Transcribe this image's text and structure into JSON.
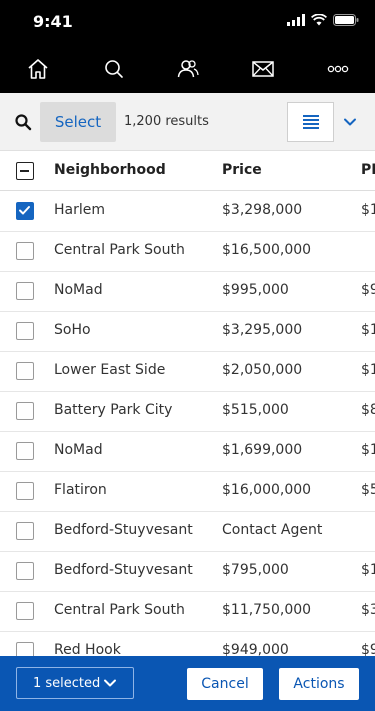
{
  "status": {
    "time": "9:41"
  },
  "nav": {
    "items": [
      {
        "icon": "home-icon"
      },
      {
        "icon": "search-icon"
      },
      {
        "icon": "people-icon"
      },
      {
        "icon": "mail-icon"
      },
      {
        "icon": "more-icon"
      }
    ]
  },
  "toolbar": {
    "select_label": "Select",
    "results_text": "1,200 results"
  },
  "table": {
    "columns": [
      "Neighborhood",
      "Price",
      "PP"
    ],
    "rows": [
      {
        "neighborhood": "Harlem",
        "price": "$3,298,000",
        "pp": "$1",
        "checked": true
      },
      {
        "neighborhood": "Central Park South",
        "price": "$16,500,000",
        "pp": "",
        "checked": false
      },
      {
        "neighborhood": "NoMad",
        "price": "$995,000",
        "pp": "$9",
        "checked": false
      },
      {
        "neighborhood": "SoHo",
        "price": "$3,295,000",
        "pp": "$1",
        "checked": false
      },
      {
        "neighborhood": "Lower East Side",
        "price": "$2,050,000",
        "pp": "$1",
        "checked": false
      },
      {
        "neighborhood": "Battery Park City",
        "price": "$515,000",
        "pp": "$8",
        "checked": false
      },
      {
        "neighborhood": "NoMad",
        "price": "$1,699,000",
        "pp": "$1",
        "checked": false
      },
      {
        "neighborhood": "Flatiron",
        "price": "$16,000,000",
        "pp": "$5",
        "checked": false
      },
      {
        "neighborhood": "Bedford-Stuyvesant",
        "price": "Contact Agent",
        "pp": "",
        "checked": false
      },
      {
        "neighborhood": "Bedford-Stuyvesant",
        "price": "$795,000",
        "pp": "$1",
        "checked": false
      },
      {
        "neighborhood": "Central Park South",
        "price": "$11,750,000",
        "pp": "$3",
        "checked": false
      },
      {
        "neighborhood": "Red Hook",
        "price": "$949,000",
        "pp": "$9",
        "checked": false
      }
    ]
  },
  "bottom": {
    "selected_label": "1 selected",
    "cancel_label": "Cancel",
    "actions_label": "Actions"
  },
  "colors": {
    "brand_blue": "#0a56b3",
    "link_blue": "#1565c0"
  }
}
